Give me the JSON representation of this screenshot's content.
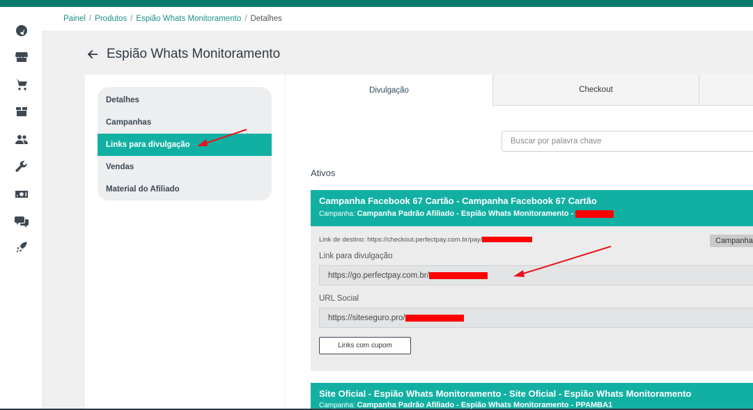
{
  "colors": {
    "accent": "#12b0a3",
    "topbar": "#0b7a6e",
    "redaction": "#ff0000",
    "annotation_arrow": "#e8141b"
  },
  "sidebar": {
    "icons": [
      "speedometer-icon",
      "store-icon",
      "cart-icon",
      "box-icon",
      "users-icon",
      "wrench-icon",
      "money-icon",
      "chat-icon",
      "rocket-icon"
    ]
  },
  "breadcrumb": {
    "items": [
      "Painel",
      "Produtos",
      "Espião Whats Monitoramento"
    ],
    "current": "Detalhes"
  },
  "page": {
    "title": "Espião Whats Monitoramento"
  },
  "menu": {
    "items": [
      "Detalhes",
      "Campanhas",
      "Links para divulgação",
      "Vendas",
      "Material do Afiliado"
    ]
  },
  "tabs": {
    "divulgacao": "Divulgação",
    "checkout": "Checkout"
  },
  "search": {
    "placeholder": "Buscar por palavra chave"
  },
  "section": {
    "active_label": "Ativos"
  },
  "campaigns": [
    {
      "title": "Campanha Facebook 67 Cartão - Campanha Facebook 67 Cartão",
      "sub_prefix": "Campanha:",
      "sub_value": "Campanha Padrão Afiliado - Espião Whats Monitoramento -",
      "dest_prefix": "Link de destino: https://checkout.perfectpay.com.br/pay/",
      "dest_badge": "Campanha",
      "link_label": "Link para divulgação",
      "link_value": "https://go.perfectpay.com.br/",
      "social_label": "URL Social",
      "social_value": "https://siteseguro.pro/",
      "coupon_button": "Links com cupom"
    },
    {
      "title": "Site Oficial - Espião Whats Monitoramento - Site Oficial - Espião Whats Monitoramento",
      "sub_prefix": "Campanha:",
      "sub_value": "Campanha Padrão Afiliado - Espião Whats Monitoramento - PPAMBA1"
    }
  ]
}
